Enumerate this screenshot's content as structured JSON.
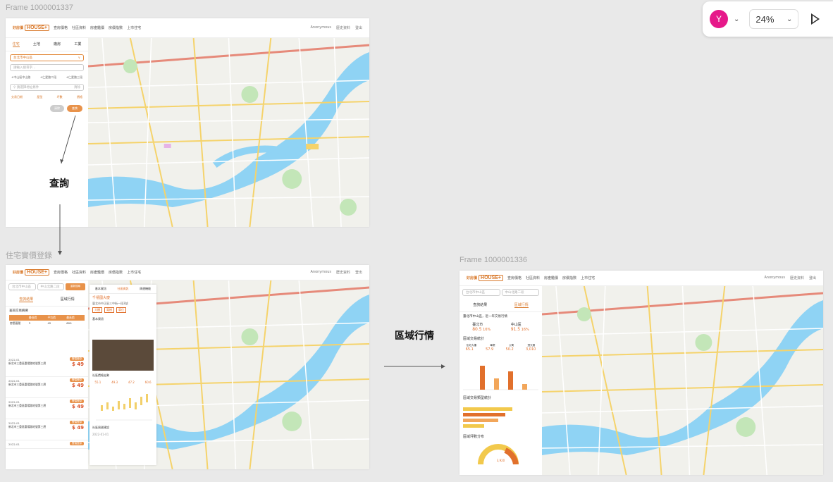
{
  "frames": {
    "top_left_label": "Frame 1000001337",
    "bottom_left_label": "住宅實價登錄",
    "right_label": "Frame 1000001336"
  },
  "annotations": {
    "query": "查詢",
    "region_market": "區域行情"
  },
  "toolbar": {
    "avatar_letter": "Y",
    "zoom": "24%"
  },
  "nav": {
    "logo_top": "好房價",
    "logo_house": "HOUSE+",
    "items": [
      "查房價格",
      "社區資料",
      "房產鑑價",
      "房價指數",
      "上市住宅"
    ],
    "right": [
      "Anonymous",
      "歷史資料",
      "登出"
    ]
  },
  "search_panel": {
    "tabs": [
      "住宅",
      "土地",
      "廠房",
      "工業"
    ],
    "city": "台北市中山區",
    "keyword_placeholder": "請輸入搜尋字…",
    "filters": [
      "中山區中山路",
      "仁愛路二段",
      "仁愛路三段"
    ],
    "address_placeholder": "請選擇地址條件",
    "address_hint": "清除",
    "options": [
      "交易日期",
      "屋型",
      "坪數",
      "價格"
    ],
    "clear": "清除",
    "submit": "查詢"
  },
  "result_panel": {
    "search_city": "台北市中山區",
    "search_road": "中山北路二段",
    "search_btn": "重新搜尋",
    "tabs": [
      "查詢結果",
      "區域行情"
    ],
    "summary_title": "查詢交易摘要",
    "summary_headers": [
      "",
      "最低價",
      "平均價",
      "最高價"
    ],
    "summary_row": [
      "房價區間",
      "3",
      "42",
      "600"
    ],
    "items": [
      {
        "date": "2022-01",
        "addr": "新北市三重區重陽路地號第三層",
        "price": "$ 49",
        "badge": "實價登錄"
      },
      {
        "date": "2022-01",
        "addr": "新北市三重區重陽路地號第三層",
        "price": "$ 49",
        "badge": "實價登錄"
      },
      {
        "date": "2022-01",
        "addr": "新北市三重區重陽路地號第三層",
        "price": "$ 49",
        "badge": "實價登錄"
      },
      {
        "date": "2022-01",
        "addr": "新北市三重區重陽路地號第三層",
        "price": "$ 49",
        "badge": "實價登錄"
      },
      {
        "date": "2022-01",
        "addr": "",
        "price": "",
        "badge": "實價登錄"
      }
    ]
  },
  "detail_panel": {
    "tabs": [
      "基本資訊",
      "社區資訊",
      "周邊機能"
    ],
    "title": "千禧國大廈",
    "address": "臺北市中正區三中街一段3號",
    "tags": [
      "大樓",
      "電梯",
      "車位"
    ],
    "section_basic": "基本資訊",
    "section_trend": "社區價格走勢",
    "stats": [
      "55.1",
      "49.3",
      "47.2",
      "60.6"
    ],
    "section_nearby": "社區周邊建設",
    "date": "2022-01-01"
  },
  "region_panel": {
    "search_city": "台北市中山區",
    "search_road": "中山北路二段",
    "tabs": [
      "查詢結果",
      "區域行情"
    ],
    "title": "臺北市中山區，近一年交易行情",
    "left_label": "臺北市",
    "left_value": "80.5",
    "left_change": "16%",
    "right_label": "中山區",
    "right_value": "91.5",
    "right_change": "16%",
    "section2": "區域交易統計",
    "stats_headers": [
      "住宅大樓",
      "華廈",
      "公寓",
      "透天厝"
    ],
    "stats_values": [
      "65.1",
      "57.9",
      "50.2",
      "3,010"
    ],
    "section3": "區域交易類型統計",
    "section4": "區域坪數分布",
    "gauge_value": "3,920"
  }
}
